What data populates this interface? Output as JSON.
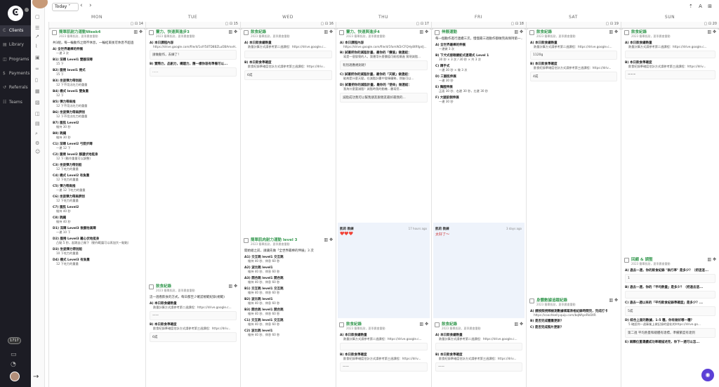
{
  "nav": [
    {
      "icon": "Ͼ",
      "label": "Clients",
      "active": true
    },
    {
      "icon": "▤",
      "label": "Library"
    },
    {
      "icon": "◫",
      "label": "Programs"
    },
    {
      "icon": "$",
      "label": "Payments"
    },
    {
      "icon": "↺",
      "label": "Referrals"
    },
    {
      "icon": "☷",
      "label": "Teams"
    }
  ],
  "badge": "1717",
  "toolbar": {
    "today": "Today ˅",
    "prev": "‹",
    "next": "›",
    "right": "⇡ A ⊞"
  },
  "days": [
    {
      "name": "MON",
      "num": "14"
    },
    {
      "name": "TUE",
      "num": "15"
    },
    {
      "name": "WED",
      "num": "16"
    },
    {
      "name": "THU",
      "num": "17"
    },
    {
      "name": "FRI",
      "num": "18"
    },
    {
      "name": "SAT",
      "num": "19"
    },
    {
      "name": "SUN",
      "num": "20"
    }
  ],
  "mon": {
    "title": "簡單肌耐力運動Week4",
    "sub": "2023 簡單肌耐，夏季晨會重動",
    "desc": "共3組，每一輪動作之間不休息，一輪結束後可休息不超過",
    "ex": [
      {
        "n": "A) 全世界最棒的伸展",
        "r": "一邊 3 次"
      },
      {
        "n": "B1) 深蹲 Level1 雙腳深蹲",
        "r": "15 下"
      },
      {
        "n": "B2) 腹捲 level1 捲式",
        "r": "15 下"
      },
      {
        "n": "B3) 坐姿彈力帶划船",
        "r": "12 下不用太吃力的重量"
      },
      {
        "n": "B4) 橋式 level1 雙負重",
        "r": "12 下"
      },
      {
        "n": "B5) 彈力帶肩推",
        "r": "12 下不用太吃力的重量"
      },
      {
        "n": "B6) 坐姿彈力帶肩胛划",
        "r": "12 下不用太吃力的重量"
      },
      {
        "n": "B7) 腹肌 Level2",
        "r": "維持 30 秒"
      },
      {
        "n": "B8) 跳繩",
        "r": "維持 30 秒"
      },
      {
        "n": "C1) 深蹲 Level2 弓箭步蹲",
        "r": "一邊 12 下"
      },
      {
        "n": "C2) 腹捲 level2 腳盪伏地挺身",
        "r": "12 下 (動作重量可以調整)"
      },
      {
        "n": "C3) 坐姿彈力帶划船",
        "r": "12 下吃力的重量"
      },
      {
        "n": "C4) 橋式 Level2 有負重",
        "r": "12 下吃力的重量"
      },
      {
        "n": "C5) 彈力帶肩推",
        "r": "一邊 12 下吃力的重量"
      },
      {
        "n": "C6) 坐姿彈力帶肩胛划",
        "r": "12 下吃力的重量"
      },
      {
        "n": "C7) 腹肌 Level2",
        "r": "維持 40 秒"
      },
      {
        "n": "C8) 跳繩",
        "r": "維持 40 秒"
      },
      {
        "n": "D1) 深蹲 Level3 後腳抬高蹲",
        "r": "一邊 10 下"
      },
      {
        "n": "D2) 腹捲 Level3 離心伏地挺身",
        "r": "凸點 5 秒，起跳自己做下（動作範圍可以再加大一點點）"
      },
      {
        "n": "D3) 坐姿彈力帶划船",
        "r": "10 下吃力的重量"
      },
      {
        "n": "D4) 橋式 Level3 有負重",
        "r": "12 下吃力的重量"
      }
    ]
  },
  "tue": {
    "title": "靈力、快速與進步3",
    "sub": "2023 簡單肌耐，夏季晨會重動",
    "ex": [
      {
        "n": "A) 本日課程內容",
        "r": "https://drive.google.com/file/d/1oIY58TD8BZLuOBAmxH..."
      },
      {
        "n": "B) 實際力，品創力，構建力，應一樣你容有準備可以...",
        "r": ""
      }
    ],
    "box1": "請做動作，去練了！",
    "box2": "......",
    "card2": {
      "title": "飲食紀錄",
      "sub": "2023 簡單肌耐，夏季晨會重動",
      "desc": "這一週看飲食的方式，每日都至少確認規範紀錄(規範)",
      "ex": [
        {
          "n": "A) 本日飲食總熱量",
          "r": "熱量計算方式請參考第二週課程：https://drive.google.c..."
        },
        {
          "n": "B) 本日飲食準確度",
          "r": "飲食紀錄準確度估計方式請參考第三週課程：https://driv..."
        }
      ],
      "box1": "——",
      "box2": "6成"
    }
  },
  "wed": {
    "title": "飲食紀錄",
    "sub": "2023 簡單肌耐，夏季晨會重動",
    "ex": [
      {
        "n": "A) 本日飲食總熱量",
        "r": "熱量計算方式請參考第二週課程：https://drive.google.c..."
      },
      {
        "n": "B) 本日飲食準確度",
        "r": "飲食紀錄準確度估計方式請參考第三週課程：https://driv..."
      }
    ],
    "box1": "",
    "box2": "6成",
    "card2": {
      "title": "簡單肌肉耐力運動 level 3",
      "sub": "2023 簡單肌耐，夏季晨會重動",
      "desc": "開始組之前，請讓先做「全世界最棒的伸展」3 次",
      "ex": [
        {
          "n": "A1) 交互跳 level1 交互跳",
          "r": "維持 40 秒、休息 60 秒"
        },
        {
          "n": "A2) 波比跳 level1",
          "r": "維持 40 秒、休息 60 秒"
        },
        {
          "n": "A3) 開合跳 level1 開合跳",
          "r": "維持 40 秒、休息 60 秒"
        },
        {
          "n": "B1) 交互跳 level1 交互跳",
          "r": "維持 40 秒、休息 60 秒"
        },
        {
          "n": "B2) 波比跳 level1",
          "r": "維持 40 秒、休息 60 秒"
        },
        {
          "n": "B3) 開合跳 level1 開合跳",
          "r": "維持 40 秒、休息 60 秒"
        },
        {
          "n": "C1) 交互跳 level1 交互跳",
          "r": "維持 40 秒、休息 60 秒"
        },
        {
          "n": "C2) 波比跳 level1",
          "r": "維持 40 秒、休息 60 秒"
        }
      ]
    }
  },
  "thu": {
    "title": "靈力、快速與進步4",
    "sub": "2023 簡單肌耐，夏季晨會重動",
    "ex": [
      {
        "n": "A) 本日課程內容",
        "r": "https://drive.google.com/file/d/1fomW2rCFQHy8tRfgnlJ..."
      },
      {
        "n": "B) 試著把你的減脂計畫，最你的「價值」做連結：",
        "r": "寫是一個發覺的人，我運用什麼價值可能程最進 實現減脂..."
      },
      {
        "n": "C) 試著把你的減脂計畫，最你的「天賦」做連結：",
        "r": "能夠是什麼天賦，在減脂計畫中發揮優勢，然後可以..."
      },
      {
        "n": "D) 試著把你的減脂計畫，最你的「使命」做連結：",
        "r": "我為什麼要減脂？減脂時我的動機…書寫您..."
      }
    ],
    "box1": "有別適應規則呢！",
    "box2": "減脂成功我可以幫我朋友跟親友最好最我的...",
    "note": {
      "name": "凱莉 教練",
      "time": "17 hours ago",
      "body": "❤️❤️❤️"
    },
    "card2": {
      "title": "飲食紀錄",
      "sub": "2023 簡單肌耐，夏季晨會重動",
      "ex": [
        {
          "n": "A) 本日飲食總熱量",
          "r": "熱量計算方式請參考第二週課程：https://drive.google.c..."
        },
        {
          "n": "B) 本日飲食準確度",
          "r": "飲食紀錄準確度估計方式請參考第三週課程：https://driv..."
        }
      ],
      "box1": "",
      "box2": "——"
    }
  },
  "fri": {
    "title": "伸展運動",
    "sub": "",
    "desc": "每一個動作進行連續三次，慢慢最三週動作都做完再保持第一...",
    "ex": [
      {
        "n": "A) 全世界最棒的伸展",
        "r": "一邊做 3 次"
      },
      {
        "n": "B) 下犬式接眼鏡蛇式連環式 Level 1",
        "r": "30 秒 × 3 次 / 30 秒 × 共 3 次"
      },
      {
        "n": "C) 蹲手式",
        "r": "一邊 30 秒 × 做 3 次"
      },
      {
        "n": "D) 三腳肌伸展",
        "r": "一邊 30 秒"
      },
      {
        "n": "E) 胸膛伸展",
        "r": "正面 30 秒、右邊 30 秒，左邊 30 秒"
      },
      {
        "n": "F) 大腿前側伸展",
        "r": "一邊 30 秒"
      }
    ],
    "note": {
      "name": "凱莉 教練",
      "time": "3 days ago",
      "body": "太好了～"
    },
    "card2": {
      "title": "飲食紀錄",
      "sub": "2023 簡單肌耐，夏季晨會重動",
      "ex": [
        {
          "n": "A) 本日飲食總熱量",
          "r": "熱量計算方式請參考第二週課程：https://drive.google.c..."
        },
        {
          "n": "B) 本日飲食準確度",
          "r": "飲食紀錄準確度估計方式請參考第三週課程：https://driv..."
        }
      ],
      "box1": "",
      "box2": "——"
    }
  },
  "sat": {
    "title": "飲食紀錄",
    "sub": "2023 簡單肌耐，夏季晨會重動",
    "ex": [
      {
        "n": "A) 本日飲食總熱量",
        "r": "熱量計算方式請參考第二週課程：https://drive.google.c..."
      },
      {
        "n": "B) 本日飲食準確度",
        "r": "飲食紀錄準確度估計方式請參考第三週課程：https://driv..."
      }
    ],
    "box1": "1120g",
    "box2": "4成",
    "card2": {
      "title": "身體數據追蹤紀錄",
      "sub": "2023 簡單肌耐，夏季晨會重動",
      "ex": [
        {
          "n": "A) 請按照視頻檢測數據填寫表格紀錄時間完，完成打卡",
          "r": "https://coachkelly.quip.com/bqNAyeRkOXR"
        },
        {
          "n": "B) 是否完成體重更新？",
          "r": ""
        },
        {
          "n": "C) 是否完成照片更新？",
          "r": ""
        }
      ]
    }
  },
  "sun": {
    "title": "飲食紀錄",
    "sub": "2023 簡單肌耐，夏季晨會重動",
    "ex": [
      {
        "n": "A) 本日飲食總熱量",
        "r": "熱量計算方式請參考第二週課程：https://drive.google.c..."
      },
      {
        "n": "B) 本日飲食準確度",
        "r": "飲食紀錄準確度估計方式請參考第三週課程：https://driv..."
      }
    ],
    "box1": "",
    "box2": "~~~",
    "card2": {
      "title": "回顧 & 調整",
      "sub": "2023 簡單肌耐，夏季晨會重動",
      "ex": [
        {
          "n": "A) 過去一週，你的飲食紀錄 \"執行率\" 是多少？（把這這...",
          "r": ""
        },
        {
          "n": "B) 過去一週，你的「平均熱量」是多少？（把過去這...",
          "r": ""
        },
        {
          "n": "C) 過去一週以來的「平均飲食紀錄準確度」是多少？...",
          "r": ""
        },
        {
          "n": "D) 綜合上面的數據，1-5 種，你有做好哪一種？",
          "r": "5 確認到一週事業上做記錄的變化的https://drive.go..."
        },
        {
          "n": "E) 兩顆位置運續成功率確描述見，你下一週可以怎...",
          "r": ""
        }
      ],
      "boxes": [
        "1",
        "",
        "5成",
        "第二週 平均熱量和總體有達標，準備繁度有達到"
      ]
    }
  }
}
